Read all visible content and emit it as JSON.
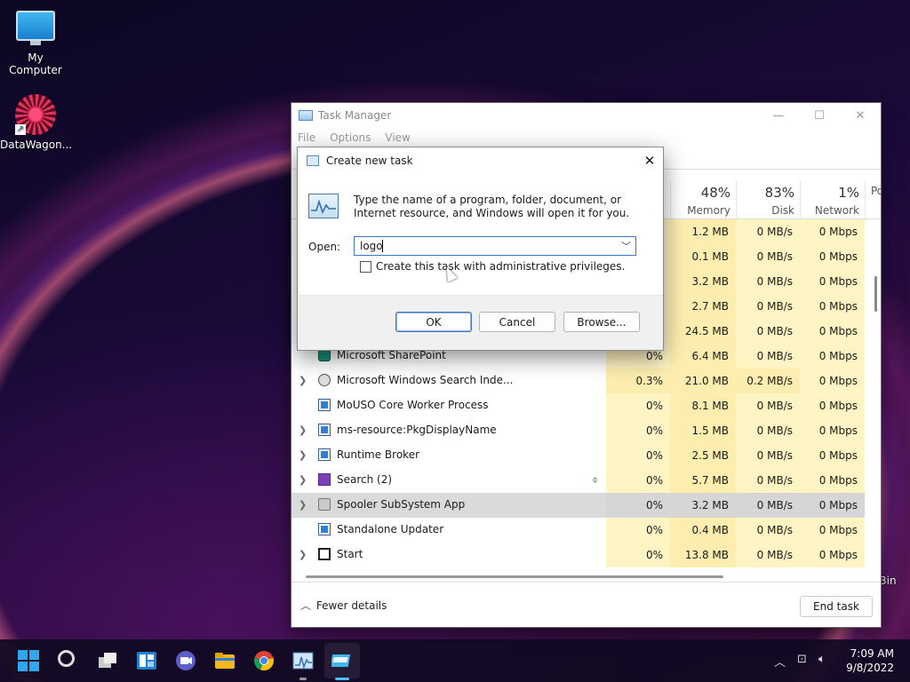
{
  "desktop": {
    "icons": [
      {
        "label": "My Computer",
        "icon": "monitor-icon"
      },
      {
        "label": "DataWagon...",
        "icon": "datawagon-icon"
      }
    ],
    "partial_label": "3in"
  },
  "task_manager": {
    "title": "Task Manager",
    "menu": [
      "File",
      "Options",
      "View"
    ],
    "columns": [
      {
        "pct": "48%",
        "label": "Memory"
      },
      {
        "pct": "83%",
        "label": "Disk"
      },
      {
        "pct": "1%",
        "label": "Network"
      },
      {
        "pct": "",
        "label": "Po"
      }
    ],
    "rows": [
      {
        "name": "",
        "cpu": "",
        "mem": "1.2 MB",
        "disk": "0 MB/s",
        "net": "0 Mbps"
      },
      {
        "name": "",
        "cpu": "",
        "mem": "0.1 MB",
        "disk": "0 MB/s",
        "net": "0 Mbps"
      },
      {
        "name": "",
        "cpu": "",
        "mem": "3.2 MB",
        "disk": "0 MB/s",
        "net": "0 Mbps"
      },
      {
        "name": "",
        "cpu": "",
        "mem": "2.7 MB",
        "disk": "0 MB/s",
        "net": "0 Mbps"
      },
      {
        "name": "",
        "cpu": "",
        "mem": "24.5 MB",
        "disk": "0 MB/s",
        "net": "0 Mbps"
      },
      {
        "name": "Microsoft SharePoint",
        "cpu": "0%",
        "mem": "6.4 MB",
        "disk": "0 MB/s",
        "net": "0 Mbps"
      },
      {
        "name": "Microsoft Windows Search Inde...",
        "cpu": "0.3%",
        "mem": "21.0 MB",
        "disk": "0.2 MB/s",
        "net": "0 Mbps"
      },
      {
        "name": "MoUSO Core Worker Process",
        "cpu": "0%",
        "mem": "8.1 MB",
        "disk": "0 MB/s",
        "net": "0 Mbps"
      },
      {
        "name": "ms-resource:PkgDisplayName",
        "cpu": "0%",
        "mem": "1.5 MB",
        "disk": "0 MB/s",
        "net": "0 Mbps"
      },
      {
        "name": "Runtime Broker",
        "cpu": "0%",
        "mem": "2.5 MB",
        "disk": "0 MB/s",
        "net": "0 Mbps"
      },
      {
        "name": "Search (2)",
        "cpu": "0%",
        "mem": "5.7 MB",
        "disk": "0 MB/s",
        "net": "0 Mbps"
      },
      {
        "name": "Spooler SubSystem App",
        "cpu": "0%",
        "mem": "3.2 MB",
        "disk": "0 MB/s",
        "net": "0 Mbps"
      },
      {
        "name": "Standalone Updater",
        "cpu": "0%",
        "mem": "0.4 MB",
        "disk": "0 MB/s",
        "net": "0 Mbps"
      },
      {
        "name": "Start",
        "cpu": "0%",
        "mem": "13.8 MB",
        "disk": "0 MB/s",
        "net": "0 Mbps"
      }
    ],
    "fewer_details": "Fewer details",
    "end_task": "End task"
  },
  "dialog": {
    "title": "Create new task",
    "description": "Type the name of a program, folder, document, or Internet resource, and Windows will open it for you.",
    "open_label": "Open:",
    "open_value": "logo",
    "admin_checkbox": "Create this task with administrative privileges.",
    "ok": "OK",
    "cancel": "Cancel",
    "browse": "Browse..."
  },
  "taskbar": {
    "time": "7:09 AM",
    "date": "9/8/2022"
  }
}
